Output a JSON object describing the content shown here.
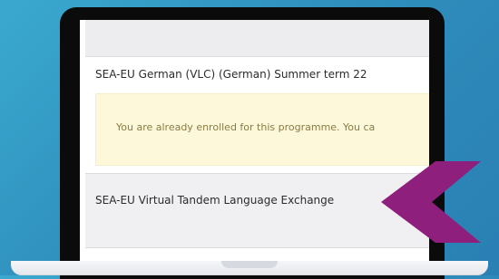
{
  "courses": [
    {
      "title": "SEA-EU German (VLC) (German) Summer term 22",
      "notice": "You are already enrolled for this programme. You ca"
    },
    {
      "title": "SEA-EU Virtual Tandem Language Exchange"
    }
  ],
  "colors": {
    "background": "#2f8fbd",
    "arrow": "#8e1f7d",
    "notice_bg": "#fdf8d9"
  },
  "icons": {
    "pointer": "left-pointing-chevron-arrow"
  }
}
